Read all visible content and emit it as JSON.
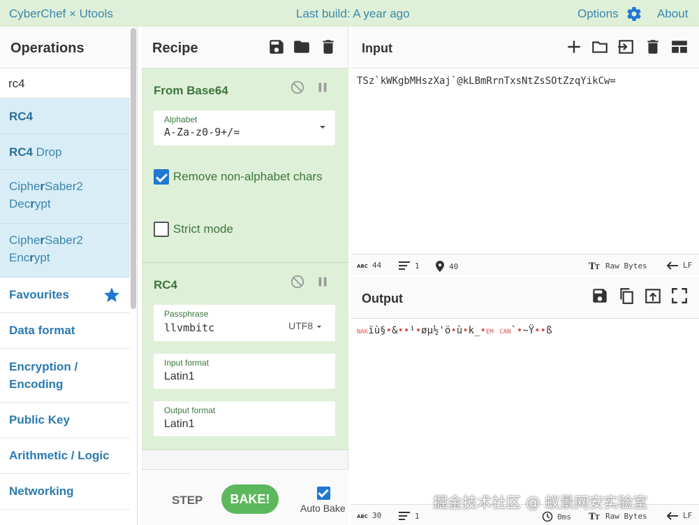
{
  "banner": {
    "app_title": "CyberChef × Utools",
    "last_build": "Last build: A year ago",
    "options_label": "Options",
    "about_label": "About"
  },
  "operations": {
    "title": "Operations",
    "search_value": "rc4",
    "results": [
      {
        "match": "RC4",
        "rest": ""
      },
      {
        "match": "RC4",
        "rest": " Drop"
      }
    ],
    "cs_decrypt": {
      "l1a": "Ciphe",
      "l1b": "r",
      "l1c": "Saber2",
      "l2a": "Dec",
      "l2b": "r",
      "l2c": "ypt"
    },
    "cs_encrypt": {
      "l1a": "Ciphe",
      "l1b": "r",
      "l1c": "Saber2",
      "l2a": "Enc",
      "l2b": "r",
      "l2c": "ypt"
    },
    "categories": {
      "favourites": "Favourites",
      "data_format": "Data format",
      "encryption_l1": "Encryption /",
      "encryption_l2": "Encoding",
      "public_key": "Public Key",
      "arith": "Arithmetic / Logic",
      "networking": "Networking"
    }
  },
  "recipe": {
    "title": "Recipe",
    "from_base64": {
      "title": "From Base64",
      "alphabet_label": "Alphabet",
      "alphabet_value": "A-Za-z0-9+/=",
      "remove_nonalpha": "Remove non-alphabet chars",
      "remove_nonalpha_checked": true,
      "strict_mode": "Strict mode",
      "strict_mode_checked": false
    },
    "rc4": {
      "title": "RC4",
      "passphrase_label": "Passphrase",
      "passphrase_value": "llvmbitc",
      "passphrase_encoding": "UTF8",
      "input_format_label": "Input format",
      "input_format_value": "Latin1",
      "output_format_label": "Output format",
      "output_format_value": "Latin1"
    },
    "step_label": "STEP",
    "bake_label": "BAKE!",
    "auto_bake_label": "Auto Bake",
    "auto_bake_checked": true
  },
  "input": {
    "title": "Input",
    "text": "TSz`kWKgbMHszXaj`@kLBmRrnTxsNtZsSOtZzqYikCw=",
    "status": {
      "length": "44",
      "lines": "1",
      "cursor": "40",
      "encoding": "Raw Bytes",
      "eol": "LF"
    }
  },
  "output": {
    "title": "Output",
    "segments": {
      "s0": "NAK",
      "s1": "ïù§",
      "s2": "•",
      "s3": "&",
      "s4": "••",
      "s5": "¹",
      "s6": "•",
      "s7": "øµ½'ö",
      "s8": "•",
      "s9": "ù",
      "s10": "•",
      "s11": "k_",
      "s12": "•",
      "s13": "EM",
      "s14": "CAN",
      "s15": "`",
      "s16": "•",
      "s17": "~Ÿ",
      "s18": "••",
      "s19": "ß"
    },
    "status": {
      "length": "30",
      "lines": "1",
      "time": "0ms",
      "encoding": "Raw Bytes",
      "eol": "LF"
    }
  },
  "watermark": "掘金技术社区 @ 蚁景网安实验室",
  "colors": {
    "accent": "#1f78d1",
    "op_green": "#3c763d",
    "bake": "#5cb85c",
    "banner_bg": "#dff0d8",
    "search_result_bg": "#d9edf7",
    "control_char": "#d9534f"
  }
}
